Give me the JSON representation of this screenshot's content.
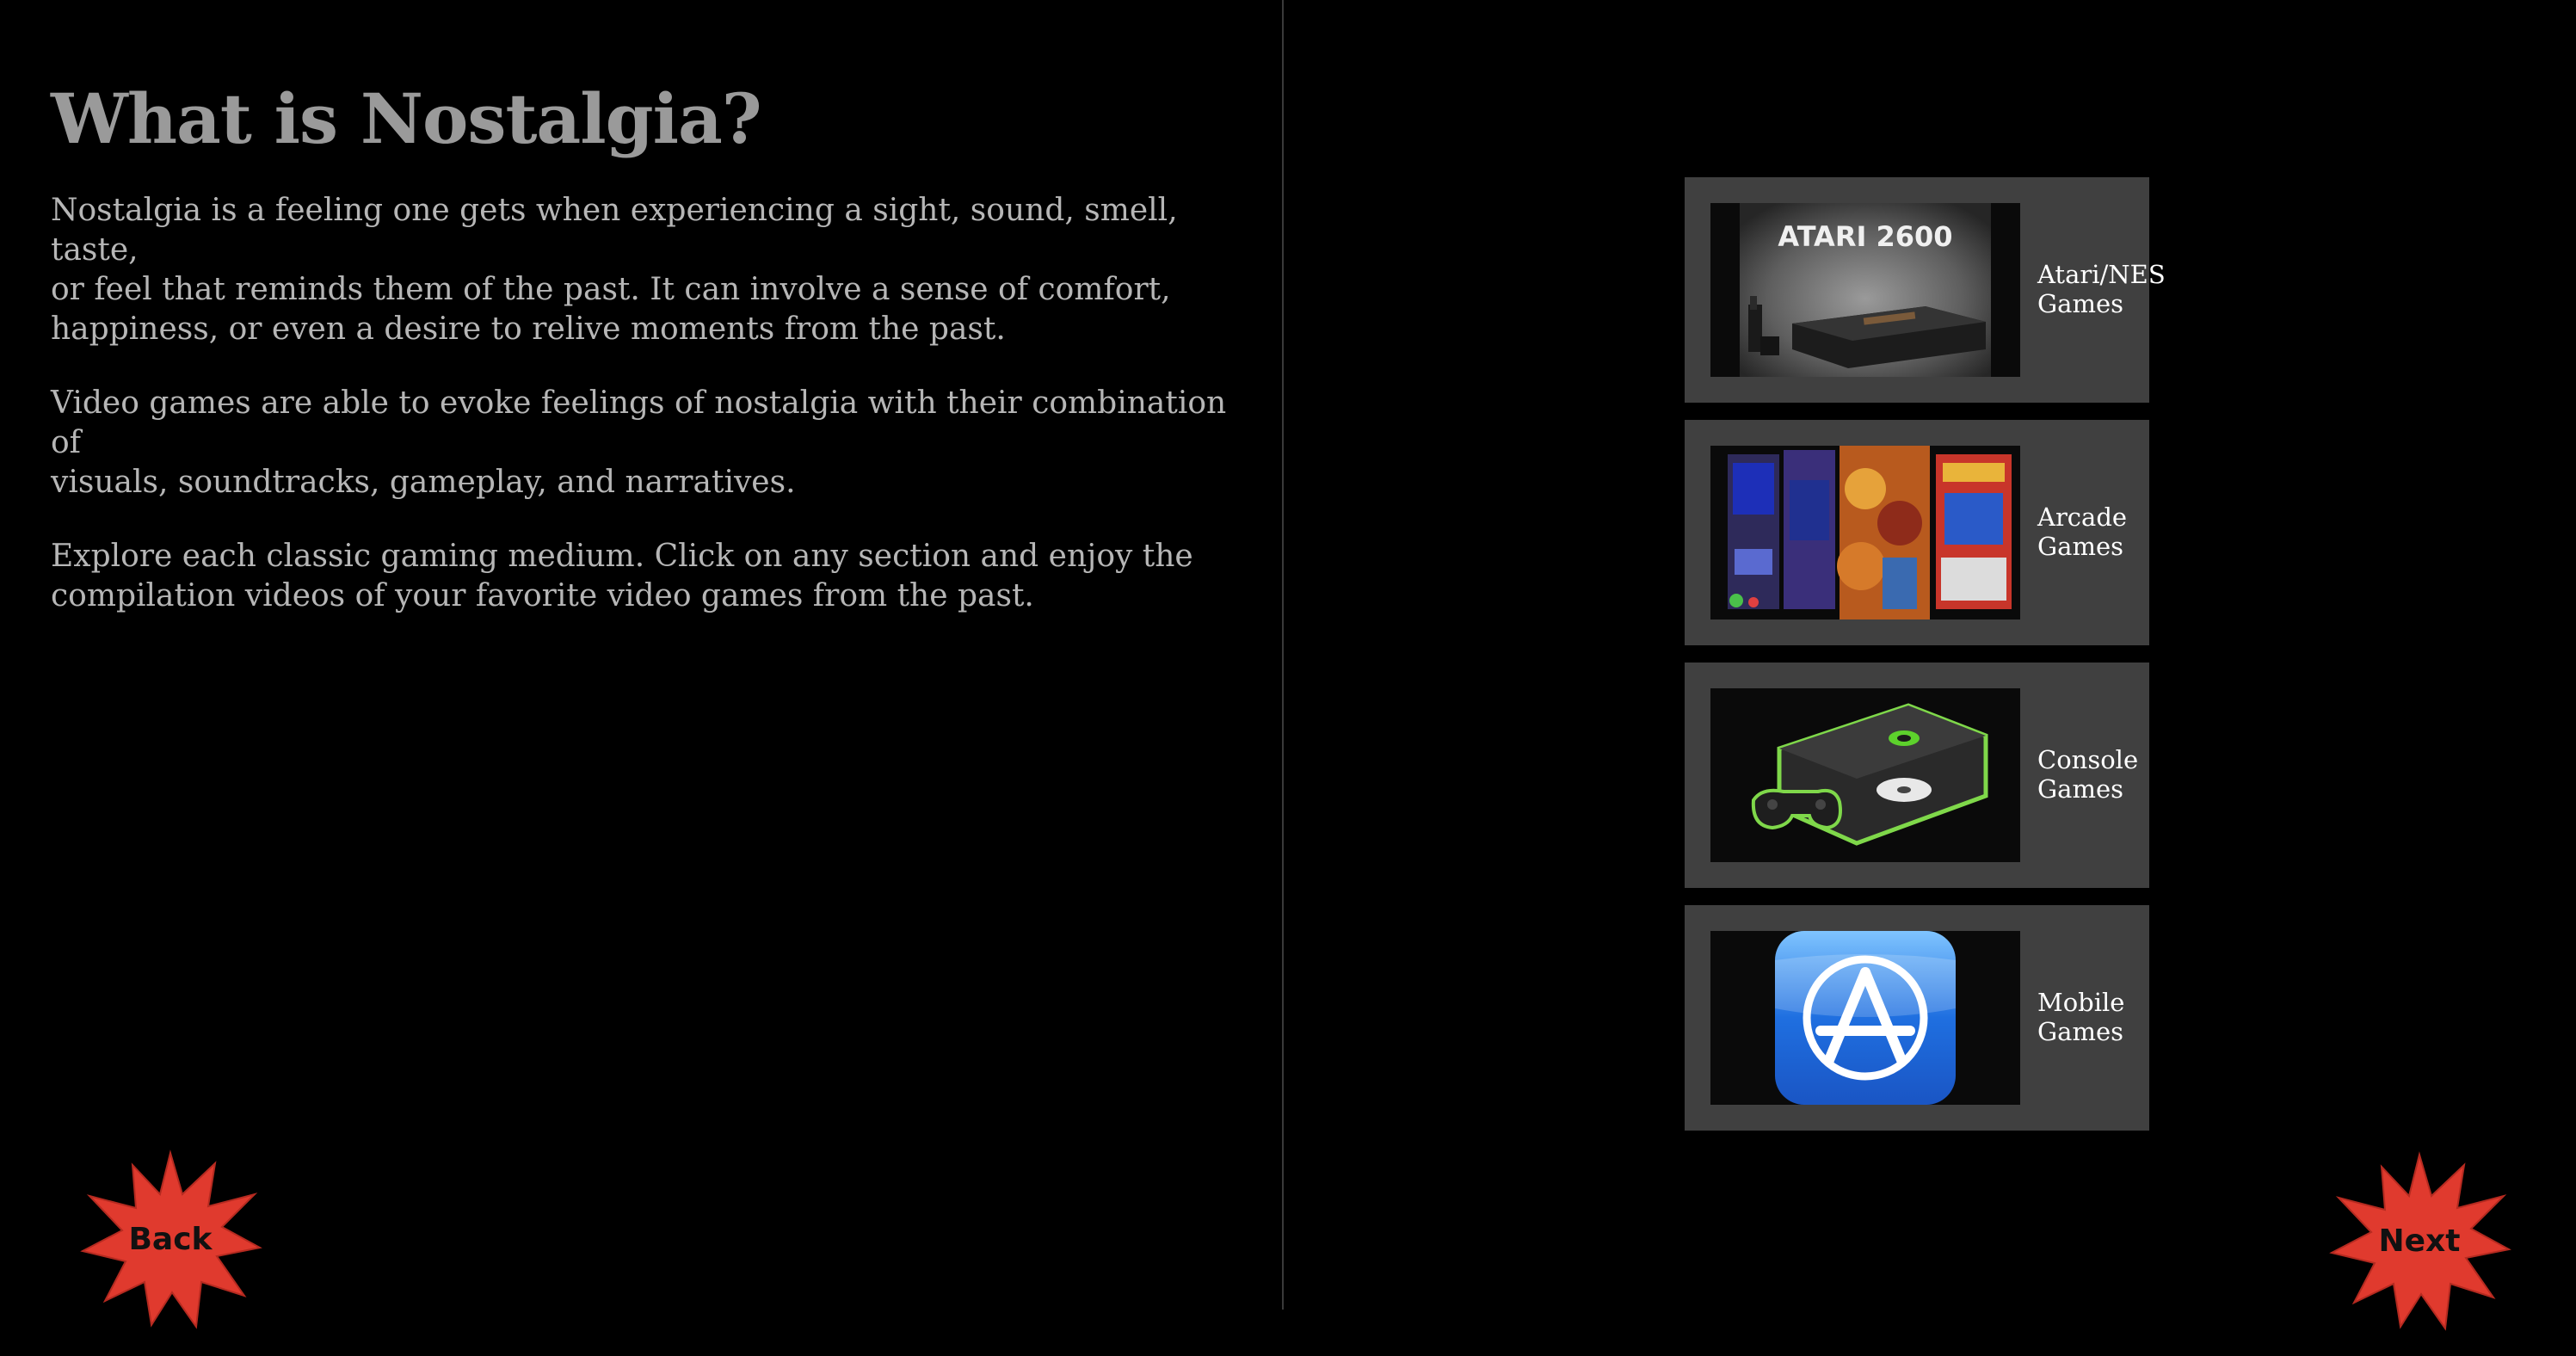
{
  "page": {
    "title": "What is Nostalgia?",
    "paragraphs": [
      "Nostalgia is a feeling one gets when experiencing a sight, sound, smell, taste,\nor feel that reminds them of the past. It can involve a sense of comfort,\nhappiness, or even a desire to relive moments from the past.",
      "Video games are able to evoke feelings of nostalgia with their combination of\nvisuals, soundtracks, gameplay, and narratives.",
      "Explore each classic gaming medium. Click on any section and enjoy the\ncompilation videos of your favorite video games from the past."
    ]
  },
  "categories": [
    {
      "label": "Atari/NES\nGames",
      "icon": "atari-2600-console-image",
      "thumb_text": "ATARI 2600"
    },
    {
      "label": "Arcade\nGames",
      "icon": "arcade-cabinets-image"
    },
    {
      "label": "Console\nGames",
      "icon": "xbox-console-image"
    },
    {
      "label": "Mobile\nGames",
      "icon": "app-store-icon"
    }
  ],
  "nav": {
    "back_label": "Back",
    "next_label": "Next"
  },
  "colors": {
    "background": "#000000",
    "title": "#9a9a9a",
    "body_text": "#b6b6b6",
    "card": "#404040",
    "burst": "#e03a2e"
  }
}
